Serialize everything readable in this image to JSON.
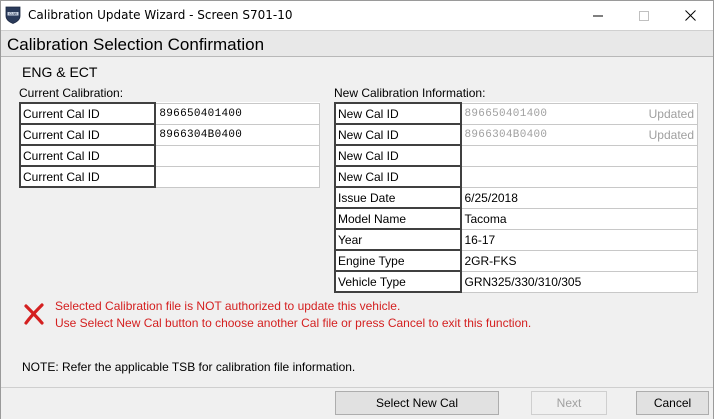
{
  "window": {
    "title": "Calibration Update Wizard - Screen S701-10",
    "icon": "techstream-shield-icon"
  },
  "page": {
    "title": "Calibration Selection Confirmation",
    "module": "ENG & ECT"
  },
  "current": {
    "label": "Current Calibration:",
    "rows": [
      {
        "label": "Current Cal ID",
        "value": "896650401400"
      },
      {
        "label": "Current Cal ID",
        "value": "8966304B0400"
      },
      {
        "label": "Current Cal ID",
        "value": ""
      },
      {
        "label": "Current Cal ID",
        "value": ""
      }
    ]
  },
  "new": {
    "label": "New Calibration Information:",
    "rows": [
      {
        "label": "New Cal ID",
        "value": "896650401400",
        "status": "Updated"
      },
      {
        "label": "New Cal ID",
        "value": "8966304B0400",
        "status": "Updated"
      },
      {
        "label": "New Cal ID",
        "value": "",
        "status": ""
      },
      {
        "label": "New Cal ID",
        "value": "",
        "status": ""
      },
      {
        "label": "Issue Date",
        "value": "6/25/2018",
        "status": ""
      },
      {
        "label": "Model Name",
        "value": "Tacoma",
        "status": ""
      },
      {
        "label": "Year",
        "value": "16-17",
        "status": ""
      },
      {
        "label": "Engine Type",
        "value": "2GR-FKS",
        "status": ""
      },
      {
        "label": "Vehicle Type",
        "value": "GRN325/330/310/305",
        "status": ""
      }
    ]
  },
  "error": {
    "line1": "Selected Calibration file is NOT authorized to update this vehicle.",
    "line2": "Use Select New Cal button to choose another Cal file or press Cancel to exit this function.",
    "color": "#d42020"
  },
  "note": "NOTE: Refer the applicable TSB for calibration file information.",
  "buttons": {
    "select_new_cal": "Select New Cal",
    "next": "Next",
    "cancel": "Cancel"
  }
}
